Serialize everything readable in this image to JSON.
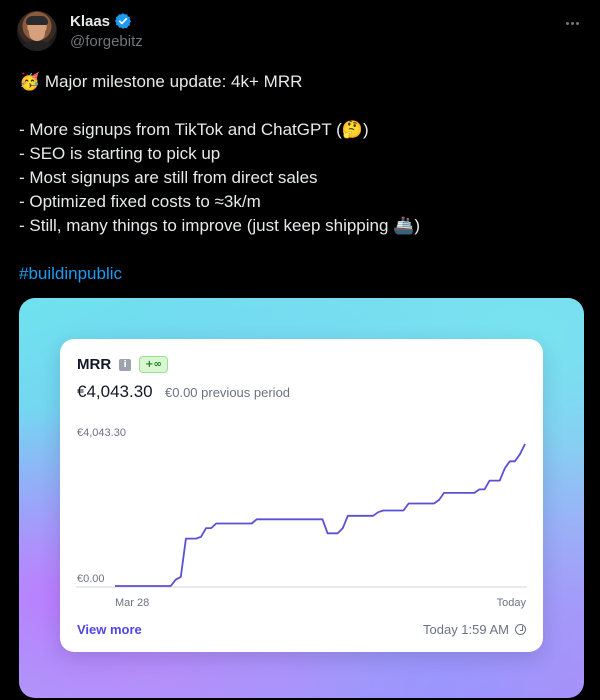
{
  "author": {
    "name": "Klaas",
    "handle": "@forgebitz",
    "verified": true
  },
  "tweet": {
    "lines": [
      {
        "emoji": "🥳",
        "text": " Major milestone update: 4k+ MRR"
      },
      {
        "text": "- More signups from TikTok and ChatGPT (",
        "emoji": "🤔",
        "tail": ")"
      },
      {
        "text": "- SEO is starting to pick up"
      },
      {
        "text": "- Most signups are still from direct sales"
      },
      {
        "text": "- Optimized fixed costs to ≈3k/m"
      },
      {
        "text": "- Still, many things to improve (just keep shipping ",
        "emoji": "🚢",
        "tail": ")"
      }
    ],
    "hashtag": "#buildinpublic"
  },
  "colors": {
    "accent": "#1d9bf0",
    "line": "#5b4fd6",
    "link": "#4f46e5"
  },
  "card": {
    "title": "MRR",
    "info_icon": "info-icon",
    "badge": "+∞",
    "value": "€4,043.30",
    "previous": "€0.00 previous period",
    "view_more": "View more",
    "updated": "Today 1:59 AM",
    "clock_icon": "clock-icon"
  },
  "chart_data": {
    "type": "line",
    "x_labels": [
      "Mar 28",
      "Today"
    ],
    "y_labels": [
      "€4,043.30",
      "€0.00"
    ],
    "ylim": [
      0,
      4043.3
    ],
    "points": 82,
    "values": [
      0,
      0,
      0,
      0,
      0,
      0,
      0,
      0,
      0,
      0,
      0,
      0,
      180,
      260,
      1350,
      1350,
      1350,
      1400,
      1650,
      1650,
      1780,
      1780,
      1780,
      1780,
      1780,
      1780,
      1780,
      1780,
      1900,
      1900,
      1900,
      1900,
      1900,
      1900,
      1900,
      1900,
      1900,
      1900,
      1900,
      1900,
      1900,
      1900,
      1500,
      1500,
      1500,
      1650,
      2000,
      2000,
      2000,
      2000,
      2000,
      2000,
      2100,
      2150,
      2150,
      2150,
      2150,
      2150,
      2350,
      2350,
      2350,
      2350,
      2350,
      2350,
      2450,
      2650,
      2650,
      2650,
      2650,
      2650,
      2650,
      2650,
      2750,
      2750,
      3000,
      3000,
      3000,
      3350,
      3550,
      3550,
      3750,
      4043.3
    ],
    "grid": false
  }
}
